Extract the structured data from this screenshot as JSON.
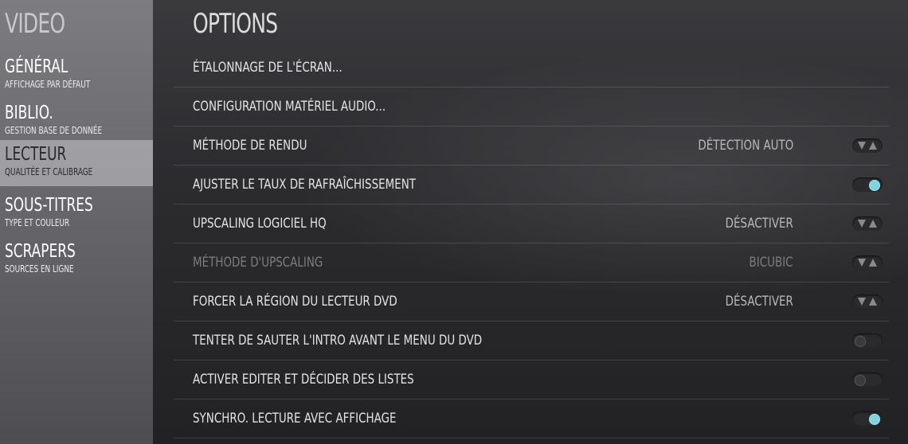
{
  "sidebar": {
    "title": "VIDEO",
    "items": [
      {
        "label": "GÉNÉRAL",
        "sub": "AFFICHAGE PAR DÉFAUT"
      },
      {
        "label": "BIBLIO.",
        "sub": "GESTION BASE DE DONNÉE"
      },
      {
        "label": "LECTEUR",
        "sub": "QUALITÉE ET CALIBRAGE"
      },
      {
        "label": "SOUS-TITRES",
        "sub": "TYPE ET COULEUR"
      },
      {
        "label": "SCRAPERS",
        "sub": "SOURCES EN LIGNE"
      }
    ],
    "active_index": 2
  },
  "main": {
    "title": "OPTIONS",
    "rows": [
      {
        "label": "ÉTALONNAGE DE L'ÉCRAN...",
        "value": "",
        "control": "none"
      },
      {
        "label": "CONFIGURATION MATÉRIEL AUDIO...",
        "value": "",
        "control": "none"
      },
      {
        "label": "MÉTHODE DE RENDU",
        "value": "DÉTECTION AUTO",
        "control": "spinner"
      },
      {
        "label": "AJUSTER LE TAUX DE RAFRAÎCHISSEMENT",
        "value": "",
        "control": "toggle-on"
      },
      {
        "label": "UPSCALING LOGICIEL HQ",
        "value": "DÉSACTIVER",
        "control": "spinner"
      },
      {
        "label": "MÉTHODE D'UPSCALING",
        "value": "BICUBIC",
        "control": "spinner",
        "disabled": true
      },
      {
        "label": "FORCER LA RÉGION DU LECTEUR DVD",
        "value": "DÉSACTIVER",
        "control": "spinner"
      },
      {
        "label": "TENTER DE SAUTER L'INTRO AVANT LE MENU DU DVD",
        "value": "",
        "control": "toggle-off"
      },
      {
        "label": "ACTIVER EDITER ET DÉCIDER DES LISTES",
        "value": "",
        "control": "toggle-off"
      },
      {
        "label": "SYNCHRO. LECTURE AVEC AFFICHAGE",
        "value": "",
        "control": "toggle-on"
      }
    ]
  },
  "colors": {
    "toggle_on": "#7fd4e0",
    "active_item_bg": "#c8c8cd"
  }
}
